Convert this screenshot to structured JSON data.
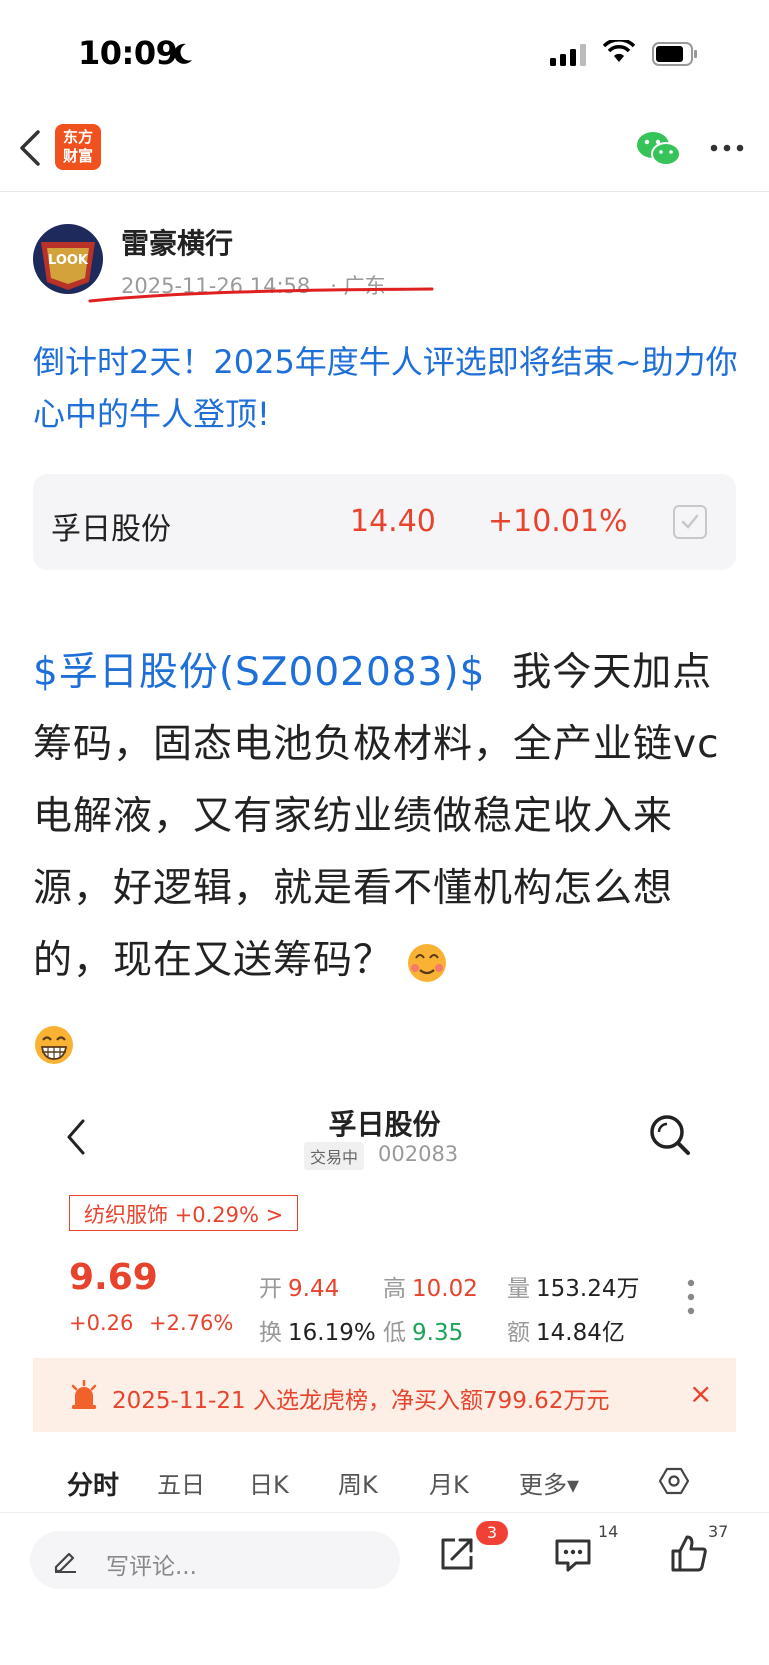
{
  "status_bar": {
    "time": "10:09",
    "icons": [
      "moon-icon",
      "signal-icon",
      "wifi-icon",
      "battery-icon"
    ]
  },
  "nav": {
    "back_icon": "chevron-left-icon",
    "app_logo_text": "东方财富",
    "share_wechat_icon": "wechat-icon",
    "more_icon": "more-horizontal-icon"
  },
  "post": {
    "author_name": "雷豪横行",
    "timestamp": "2025-11-26 14:58",
    "location": "· 广东",
    "promo_banner": "倒计时2天！2025年度牛人评选即将结束~助力你心中的牛人登顶!",
    "stock_card": {
      "name": "孚日股份",
      "price": "14.40",
      "change": "+10.01%"
    },
    "stock_tag": "$孚日股份(SZ002083)$",
    "body": "我今天加点筹码，固态电池负极材料，全产业链vc电解液，又有家纺业绩做稳定收入来源，好逻辑，就是看不懂机构怎么想的，现在又送筹码？",
    "emojis": [
      "dizzy-smile-emoji",
      "grin-emoji"
    ]
  },
  "embedded_screenshot": {
    "title": "孚日股份",
    "trading_status": "交易中",
    "code": "002083",
    "sector_tag": "纺织服饰 +0.29% >",
    "price": "9.69",
    "change_abs": "+0.26",
    "change_pct": "+2.76%",
    "stats": {
      "open_label": "开",
      "open_value": "9.44",
      "high_label": "高",
      "high_value": "10.02",
      "volume_label": "量",
      "volume_value": "153.24万",
      "turnover_label": "换",
      "turnover_value": "16.19%",
      "low_label": "低",
      "low_value": "9.35",
      "amount_label": "额",
      "amount_value": "14.84亿"
    },
    "alert_text": "2025-11-21 入选龙虎榜，净买入额799.62万元",
    "alert_close": "×",
    "tabs": [
      "分时",
      "五日",
      "日K",
      "周K",
      "月K",
      "更多▾"
    ]
  },
  "bottom_bar": {
    "comment_placeholder": "写评论...",
    "share_badge": "3",
    "comment_count": "14",
    "like_count": "37"
  },
  "colors": {
    "accent_blue": "#1f6fd8",
    "stock_red": "#e8432c",
    "stock_green": "#1ca35a",
    "brand_orange": "#f0511d"
  }
}
